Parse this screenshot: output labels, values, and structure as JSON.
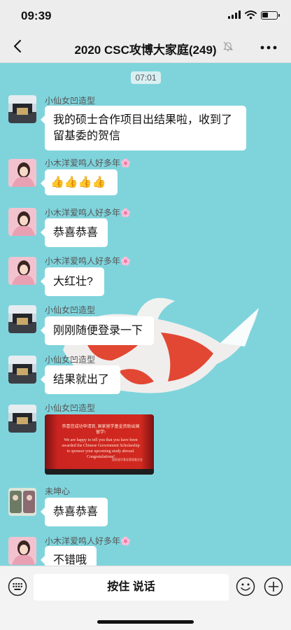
{
  "status_bar": {
    "time": "09:39"
  },
  "nav": {
    "title": "2020 CSC攻博大家庭(249)"
  },
  "chat": {
    "timestamp": "07:01",
    "messages": [
      {
        "sender": "小仙女凹造型",
        "text_lines": [
          "我的硕士合作项目出结果啦，收到了",
          "留基委的贺信"
        ]
      },
      {
        "sender": "小木洋爱鸣人好多年🌸",
        "text": "👍👍👍👍"
      },
      {
        "sender": "小木洋爱鸣人好多年🌸",
        "text": "恭喜恭喜"
      },
      {
        "sender": "小木洋爱鸣人好多年🌸",
        "text": "大红壮?"
      },
      {
        "sender": "小仙女凹造型",
        "text": "刚刚随便登录一下"
      },
      {
        "sender": "小仙女凹造型",
        "text": "结果就出了"
      },
      {
        "sender": "小仙女凹造型",
        "image": {
          "header": "恭喜您成功申请到, 国家留学基金资助出国留学!",
          "body": "We are happy to tell you that you have been awarded the Chinese Government Scholarship to sponsor your upcoming study abroad. Congratulations!",
          "signature": "国家留学基金管理委员会"
        }
      },
      {
        "sender": "未坤心",
        "text": "恭喜恭喜"
      },
      {
        "sender": "小木洋爱鸣人好多年🌸",
        "text": "不错哦"
      }
    ]
  },
  "input": {
    "hold_to_talk": "按住 说话"
  },
  "colors": {
    "chat_bg": "#7fd4dc",
    "koi_red": "#e8402a"
  },
  "icons": [
    "back-icon",
    "mute-icon",
    "more-icon",
    "keyboard-icon",
    "emoji-icon",
    "plus-icon"
  ]
}
